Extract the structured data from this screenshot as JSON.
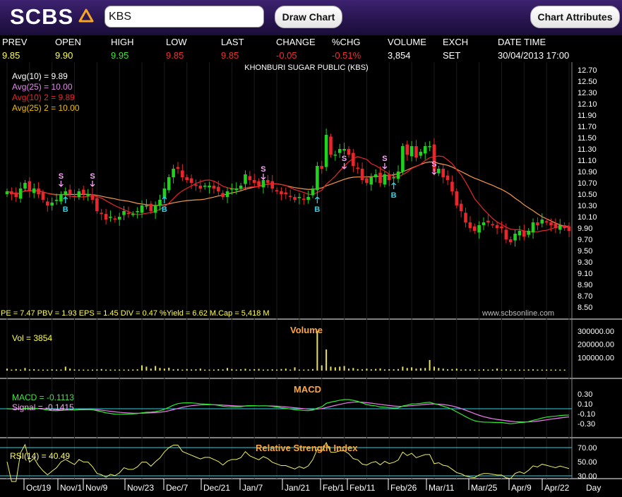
{
  "app": {
    "logo_text": "SCBS"
  },
  "toolbar": {
    "symbol_value": "KBS",
    "draw_chart_label": "Draw Chart",
    "chart_attributes_label": "Chart Attributes"
  },
  "quote": {
    "headers": {
      "prev": "PREV",
      "open": "OPEN",
      "high": "HIGH",
      "low": "LOW",
      "last": "LAST",
      "change": "CHANGE",
      "pchg": "%CHG",
      "volume": "VOLUME",
      "exch": "EXCH",
      "datetime": "DATE TIME"
    },
    "values": {
      "prev": "9.85",
      "open": "9.90",
      "high": "9.95",
      "low": "9.85",
      "last": "9.85",
      "change": "-0.05",
      "pchg": "-0.51%",
      "volume": "3,854",
      "exch": "SET",
      "datetime": "30/04/2013 17:00"
    }
  },
  "colors": {
    "up": "#1ed21e",
    "down": "#e8262b",
    "avg10": "#e8262b",
    "avg25": "#f59a4a",
    "yellow": "#ffff4d",
    "orange": "#ffa63a",
    "cyan": "#2ad4e8",
    "pink": "#f7a6f7",
    "purple_bar": "#2c1557"
  },
  "price_panel": {
    "title": "KHONBURI SUGAR PUBLIC (KBS)",
    "legend": [
      {
        "label": "Avg(10)  =  9.89",
        "color": "#ffffff"
      },
      {
        "label": "Avg(25)  =  10.00",
        "color": "#e08ae8"
      },
      {
        "label": "Avg(10) 2  =  9.89",
        "color": "#e8262b"
      },
      {
        "label": "Avg(25) 2  =  10.00",
        "color": "#f0c000"
      }
    ],
    "y_ticks": [
      "12.70",
      "12.50",
      "12.30",
      "12.10",
      "11.90",
      "11.70",
      "11.50",
      "11.30",
      "11.10",
      "10.90",
      "10.70",
      "10.50",
      "10.30",
      "10.10",
      "9.90",
      "9.70",
      "9.50",
      "9.30",
      "9.10",
      "8.90",
      "8.70",
      "8.50"
    ],
    "fundamentals": "PE = 7.47   PBV = 1.93   EPS = 1.45   DIV = 0.47   %Yield = 6.62   M.Cap = 5,418 M",
    "source": "www.scbsonline.com",
    "signal_sell": "S",
    "signal_buy": "B"
  },
  "volume_panel": {
    "title": "Volume",
    "readout": "Vol  =  3854",
    "y_ticks": [
      "300000.00",
      "200000.00",
      "100000.00"
    ]
  },
  "macd_panel": {
    "title": "MACD",
    "macd_readout": "MACD  =  -0.1113",
    "signal_readout": "Signal  =  -0.1415",
    "y_ticks": [
      "0.30",
      "0.10",
      "-0.10",
      "-0.30"
    ]
  },
  "rsi_panel": {
    "title": "Relative Strength Index",
    "readout": "RSI(14)  =  40.49",
    "y_ticks": [
      "70.00",
      "50.00",
      "30.00"
    ]
  },
  "x_axis": {
    "labels": [
      "Oct/19",
      "Nov/1",
      "Nov/9",
      "Nov/23",
      "Dec/7",
      "Dec/21",
      "Jan/7",
      "Jan/21",
      "Feb/1",
      "Feb/11",
      "Feb/26",
      "Mar/11",
      "Mar/25",
      "Apr/9",
      "Apr/22"
    ],
    "unit": "Day"
  },
  "chart_data": {
    "type": "candlestick",
    "title": "KHONBURI SUGAR PUBLIC (KBS)",
    "ylim": [
      8.5,
      12.7
    ],
    "close": [
      10.55,
      10.5,
      10.45,
      10.6,
      10.7,
      10.55,
      10.6,
      10.5,
      10.4,
      10.3,
      10.35,
      10.4,
      10.5,
      10.55,
      10.5,
      10.45,
      10.55,
      10.5,
      10.5,
      10.4,
      10.2,
      10.15,
      10.05,
      10.1,
      10.05,
      10.1,
      10.2,
      10.15,
      10.15,
      10.2,
      10.3,
      10.3,
      10.2,
      10.3,
      10.4,
      10.6,
      10.8,
      10.95,
      10.95,
      10.8,
      10.75,
      10.7,
      10.65,
      10.6,
      10.65,
      10.65,
      10.6,
      10.55,
      10.45,
      10.55,
      10.6,
      10.6,
      10.65,
      10.85,
      10.75,
      10.7,
      10.65,
      10.75,
      10.7,
      10.6,
      10.55,
      10.5,
      10.5,
      10.45,
      10.4,
      10.45,
      10.4,
      10.45,
      10.6,
      11.0,
      10.95,
      11.55,
      11.2,
      11.2,
      11.3,
      11.3,
      11.2,
      11.0,
      10.95,
      10.75,
      10.7,
      10.8,
      10.85,
      10.7,
      10.85,
      10.75,
      10.8,
      10.9,
      11.35,
      11.2,
      11.35,
      11.15,
      11.25,
      11.35,
      11.35,
      10.9,
      10.95,
      10.8,
      10.75,
      10.55,
      10.3,
      10.2,
      10.0,
      9.9,
      9.85,
      9.95,
      10.0,
      10.0,
      9.95,
      9.9,
      9.9,
      9.7,
      9.65,
      9.8,
      9.85,
      9.75,
      9.85,
      10.0,
      9.95,
      10.05,
      10.0,
      9.95,
      9.9,
      9.95,
      9.9,
      9.85
    ],
    "volume": [
      15000,
      8000,
      12000,
      6000,
      20000,
      9000,
      11000,
      7000,
      5000,
      4000,
      10000,
      6000,
      8000,
      30000,
      15000,
      9000,
      6000,
      5000,
      7000,
      8000,
      9000,
      12000,
      6000,
      5000,
      6000,
      4000,
      7000,
      8000,
      9000,
      10000,
      40000,
      30000,
      15000,
      35000,
      20000,
      15000,
      22000,
      10000,
      12000,
      8000,
      12000,
      9000,
      10000,
      15000,
      7000,
      6000,
      8000,
      11000,
      9000,
      20000,
      12000,
      8000,
      10000,
      14000,
      9000,
      11000,
      13000,
      8000,
      9000,
      10000,
      7000,
      12000,
      15000,
      8000,
      25000,
      6000,
      7000,
      9000,
      12000,
      300000,
      40000,
      160000,
      30000,
      25000,
      30000,
      35000,
      15000,
      20000,
      12000,
      10000,
      15000,
      10000,
      13000,
      16000,
      9000,
      11000,
      10000,
      12000,
      30000,
      20000,
      25000,
      15000,
      18000,
      20000,
      80000,
      30000,
      20000,
      15000,
      10000,
      12000,
      15000,
      8000,
      10000,
      9000,
      7000,
      8000,
      10000,
      6000,
      9000,
      15000,
      8000,
      10000,
      5000,
      7000,
      8000,
      6000,
      9000,
      10000,
      7000,
      8000,
      6000,
      5000,
      7000,
      6000,
      4000
    ]
  }
}
